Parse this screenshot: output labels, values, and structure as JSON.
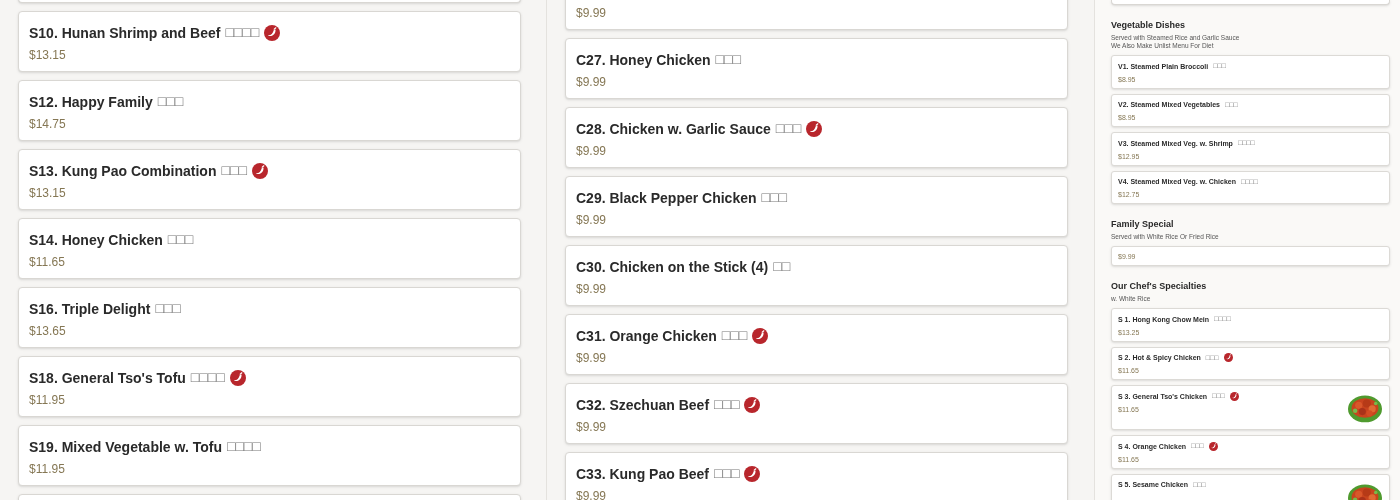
{
  "columns": [
    {
      "sections": [
        {
          "items": [
            {
              "kind": "edge"
            },
            {
              "kind": "plain",
              "name": "S10. Hunan Shrimp and Beef",
              "chinese": "□□□□",
              "spicy": true,
              "price": "$13.15"
            },
            {
              "kind": "plain",
              "name": "S12. Happy Family",
              "chinese": "□□□",
              "spicy": false,
              "price": "$14.75"
            },
            {
              "kind": "plain",
              "name": "S13. Kung Pao Combination",
              "chinese": "□□□",
              "spicy": true,
              "price": "$13.15"
            },
            {
              "kind": "plain",
              "name": "S14. Honey Chicken",
              "chinese": "□□□",
              "spicy": false,
              "price": "$11.65"
            },
            {
              "kind": "plain",
              "name": "S16. Triple Delight",
              "chinese": "□□□",
              "spicy": false,
              "price": "$13.65"
            },
            {
              "kind": "plain",
              "name": "S18. General Tso's Tofu",
              "chinese": "□□□□",
              "spicy": true,
              "price": "$11.95"
            },
            {
              "kind": "plain",
              "name": "S19. Mixed Vegetable w. Tofu",
              "chinese": "□□□□",
              "spicy": false,
              "price": "$11.95"
            },
            {
              "kind": "edge"
            }
          ]
        }
      ]
    },
    {
      "sections": [
        {
          "items": [
            {
              "kind": "plain",
              "price": "$9.99"
            },
            {
              "kind": "plain",
              "name": "C27. Honey Chicken",
              "chinese": "□□□",
              "spicy": false,
              "price": "$9.99"
            },
            {
              "kind": "plain",
              "name": "C28. Chicken w. Garlic Sauce",
              "chinese": "□□□",
              "spicy": true,
              "price": "$9.99"
            },
            {
              "kind": "plain",
              "name": "C29. Black Pepper Chicken",
              "chinese": "□□□",
              "spicy": false,
              "price": "$9.99"
            },
            {
              "kind": "plain",
              "name": "C30. Chicken on the Stick (4)",
              "chinese": "□□",
              "spicy": false,
              "price": "$9.99"
            },
            {
              "kind": "plain",
              "name": "C31. Orange Chicken",
              "chinese": "□□□",
              "spicy": true,
              "price": "$9.99"
            },
            {
              "kind": "plain",
              "name": "C32. Szechuan Beef",
              "chinese": "□□□",
              "spicy": true,
              "price": "$9.99"
            },
            {
              "kind": "plain",
              "name": "C33. Kung Pao Beef",
              "chinese": "□□□",
              "spicy": true,
              "price": "$9.99"
            }
          ]
        }
      ]
    },
    {
      "sections": [
        {
          "items": [
            {
              "kind": "edge"
            }
          ]
        },
        {
          "title": "Vegetable Dishes",
          "subtitles": [
            "Served with Steamed Rice and Garlic Sauce",
            "We Also Make Unlist Menu For Diet"
          ],
          "items": [
            {
              "kind": "plain",
              "name": "V1. Steamed Plain Broccoli",
              "chinese": "□□□",
              "spicy": false,
              "price": "$8.95"
            },
            {
              "kind": "plain",
              "name": "V2. Steamed Mixed Vegetables",
              "chinese": "□□□",
              "spicy": false,
              "price": "$8.95"
            },
            {
              "kind": "plain",
              "name": "V3. Steamed Mixed Veg. w. Shrimp",
              "chinese": "□□□□",
              "spicy": false,
              "price": "$12.95"
            },
            {
              "kind": "plain",
              "name": "V4. Steamed Mixed Veg. w. Chicken",
              "chinese": "□□□□",
              "spicy": false,
              "price": "$12.75"
            }
          ]
        },
        {
          "title": "Family Special",
          "subtitles": [
            "Served with White Rice Or Fried Rice"
          ],
          "items": [
            {
              "kind": "plain",
              "price": "$9.99"
            }
          ]
        },
        {
          "title": "Our Chef's Specialties",
          "subtitles": [
            "w. White Rice"
          ],
          "items": [
            {
              "kind": "plain",
              "name": "S 1. Hong Kong Chow Mein",
              "chinese": "□□□□",
              "spicy": false,
              "price": "$13.25"
            },
            {
              "kind": "plain",
              "name": "S 2. Hot & Spicy Chicken",
              "chinese": "□□□",
              "spicy": true,
              "price": "$11.65"
            },
            {
              "name": "S 3. General Tso's Chicken",
              "chinese": "□□□",
              "spicy": true,
              "price": "$11.65"
            },
            {
              "kind": "plain",
              "name": "S 4. Orange Chicken",
              "chinese": "□□□",
              "spicy": true,
              "price": "$11.65"
            },
            {
              "name": "S 5. Sesame Chicken",
              "chinese": "□□□",
              "spicy": false
            }
          ]
        }
      ]
    }
  ]
}
